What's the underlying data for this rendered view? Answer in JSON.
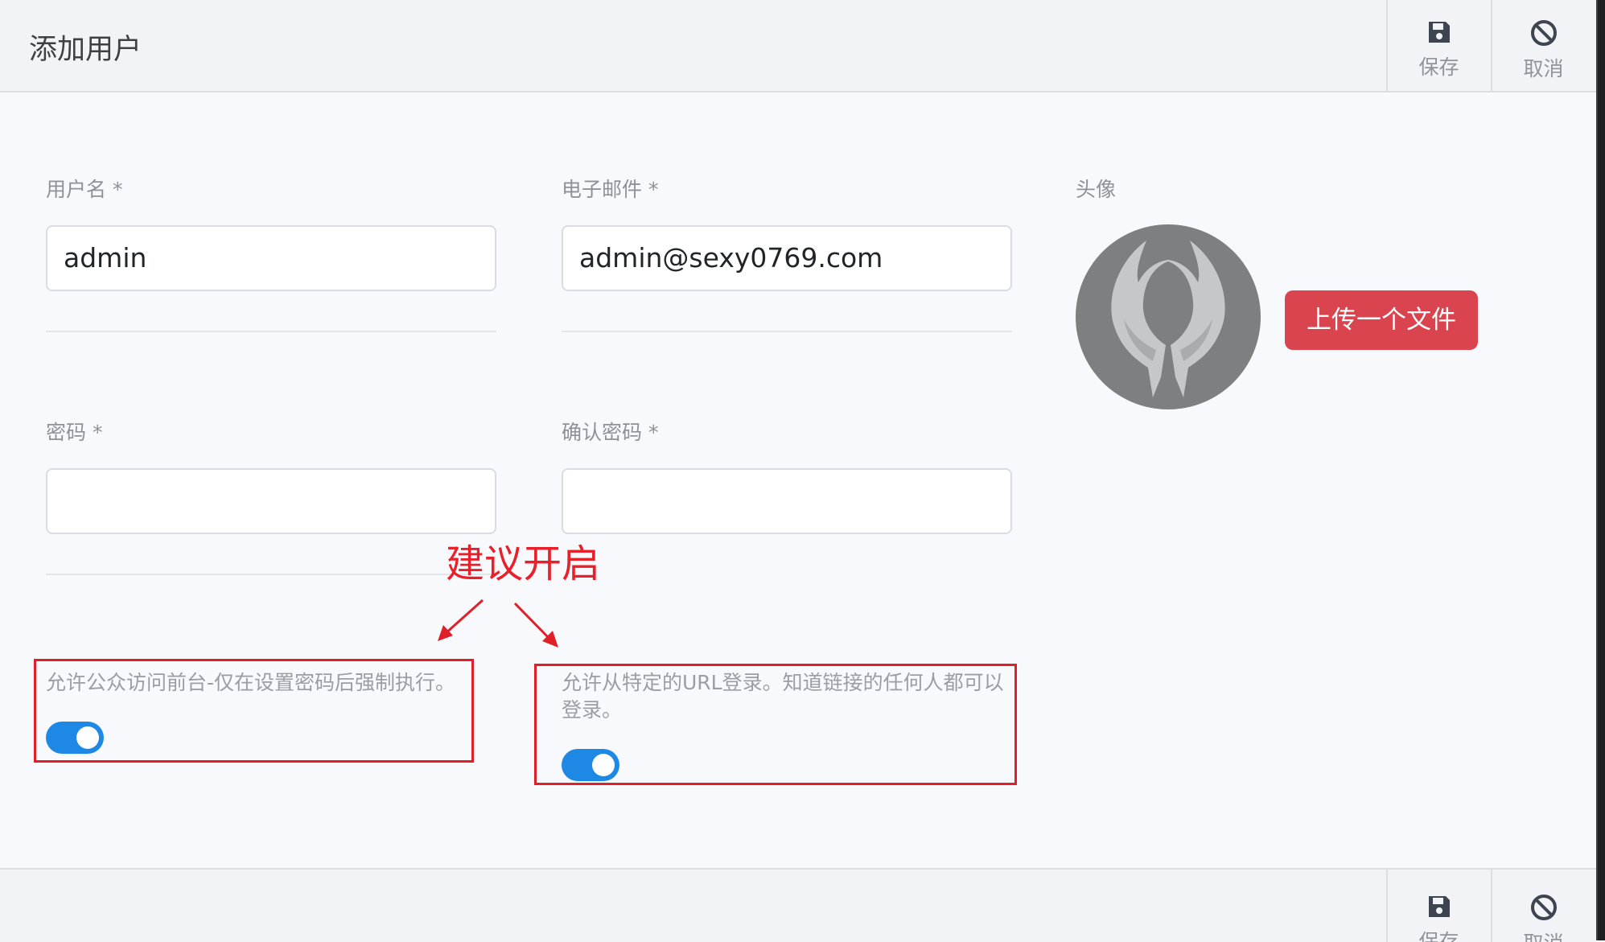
{
  "header": {
    "title": "添加用户"
  },
  "toolbar": {
    "save_label": "保存",
    "cancel_label": "取消"
  },
  "form": {
    "username": {
      "label": "用户名 *",
      "value": "admin"
    },
    "email": {
      "label": "电子邮件 *",
      "value": "admin@sexy0769.com"
    },
    "password": {
      "label": "密码 *",
      "value": ""
    },
    "confirm_password": {
      "label": "确认密码 *",
      "value": ""
    },
    "avatar": {
      "label": "头像",
      "upload_label": "上传一个文件"
    },
    "public_access": {
      "text": "允许公众访问前台-仅在设置密码后强制执行。",
      "enabled": true
    },
    "url_login": {
      "text": "允许从特定的URL登录。知道链接的任何人都可以登录。",
      "enabled": true
    }
  },
  "annotation": {
    "text": "建议开启",
    "color": "#e8202a"
  },
  "colors": {
    "toggle_on": "#1e88e5",
    "upload_button": "#d9444f"
  }
}
